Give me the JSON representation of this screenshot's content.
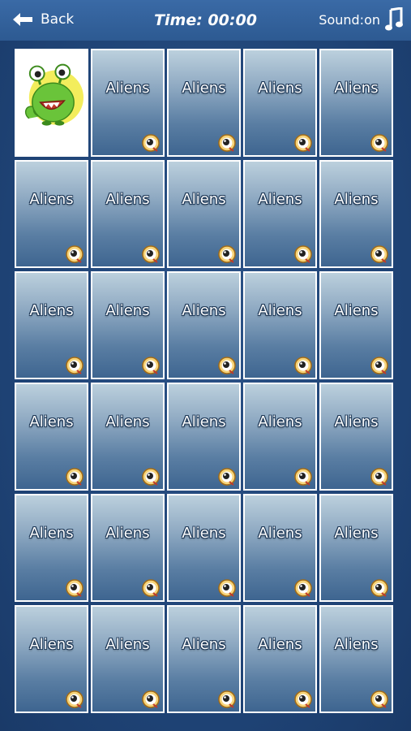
{
  "header": {
    "back_label": "Back",
    "title": "Time: 00:00",
    "sound_label": "Sound:on"
  },
  "cards": [
    {
      "state": "revealed",
      "image": "green-alien-icon"
    },
    {
      "label": "Aliens"
    },
    {
      "label": "Aliens"
    },
    {
      "label": "Aliens"
    },
    {
      "label": "Aliens"
    },
    {
      "label": "Aliens"
    },
    {
      "label": "Aliens"
    },
    {
      "label": "Aliens"
    },
    {
      "label": "Aliens"
    },
    {
      "label": "Aliens"
    },
    {
      "label": "Aliens"
    },
    {
      "label": "Aliens"
    },
    {
      "label": "Aliens"
    },
    {
      "label": "Aliens"
    },
    {
      "label": "Aliens"
    },
    {
      "label": "Aliens"
    },
    {
      "label": "Aliens"
    },
    {
      "label": "Aliens"
    },
    {
      "label": "Aliens"
    },
    {
      "label": "Aliens"
    },
    {
      "label": "Aliens"
    },
    {
      "label": "Aliens"
    },
    {
      "label": "Aliens"
    },
    {
      "label": "Aliens"
    },
    {
      "label": "Aliens"
    },
    {
      "label": "Aliens"
    },
    {
      "label": "Aliens"
    },
    {
      "label": "Aliens"
    },
    {
      "label": "Aliens"
    },
    {
      "label": "Aliens"
    }
  ],
  "colors": {
    "header": "#3a6aa6",
    "background": "#23487a",
    "card_top": "#bcd0dd",
    "card_bottom": "#3e6590",
    "alien_green": "#6ac43a",
    "alien_glow": "#f1ea3f"
  },
  "icons": {
    "back": "back-arrow-icon",
    "sound": "music-note-icon",
    "card_badge": "eye-icon"
  }
}
